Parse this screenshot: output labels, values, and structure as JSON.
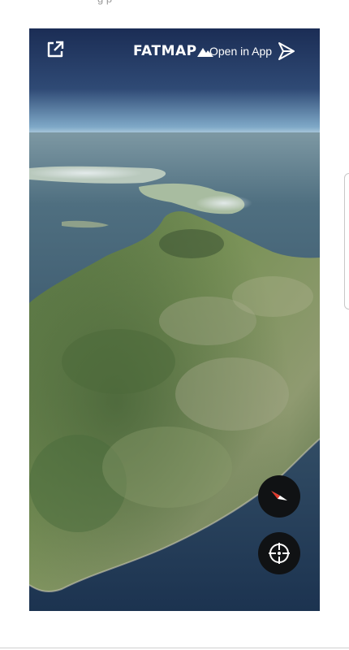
{
  "page": {
    "top_text": "g   p"
  },
  "map": {
    "brand": "FATMAP",
    "open_in_app": "Open in App",
    "colors": {
      "sky_top": "#1b2d55",
      "horizon": "#9fc3da",
      "sea": "#2f4f66",
      "land": "#6f8a4e",
      "compass_red": "#e23b2e"
    }
  },
  "icons": {
    "expand": "external-link-icon",
    "brand_logo": "mountain-icon",
    "app_store": "play-arrow-icon",
    "compass": "compass-icon",
    "locate": "crosshair-icon"
  }
}
